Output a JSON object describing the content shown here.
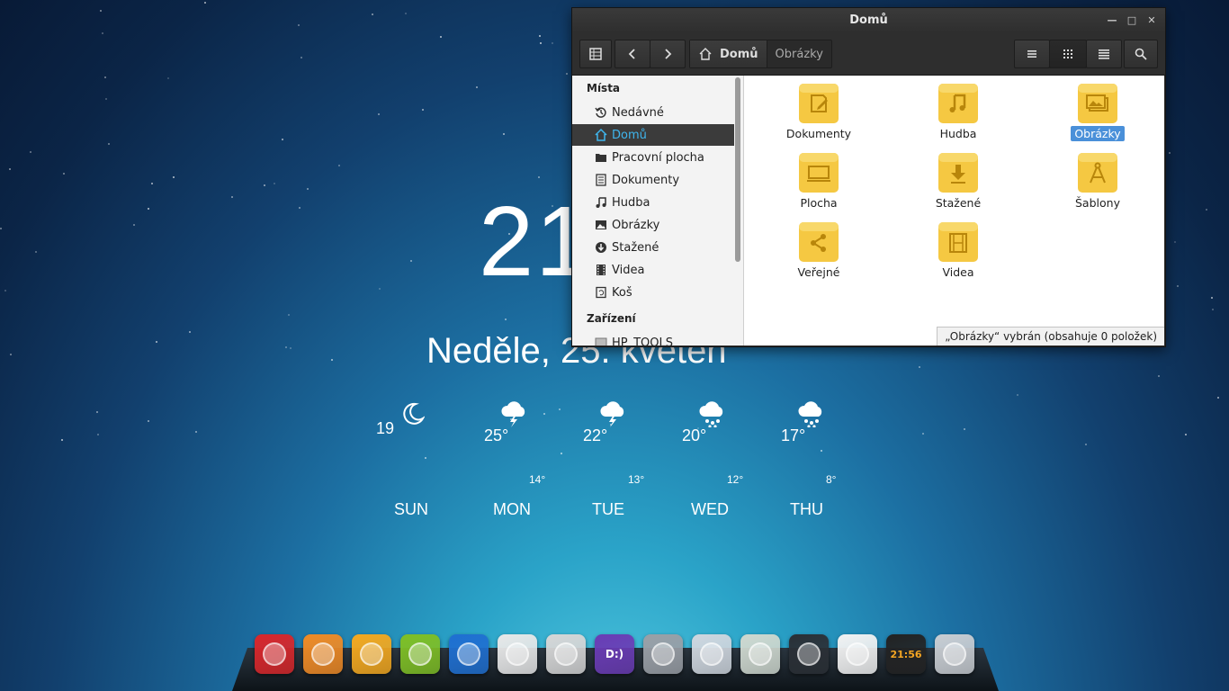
{
  "desktop": {
    "clock_text": "21",
    "date_text": "Neděle, 25. květen",
    "forecast": [
      {
        "day": "SUN",
        "high": "19",
        "low": "",
        "icon": "moon-icon"
      },
      {
        "day": "MON",
        "high": "25°",
        "low": "14°",
        "icon": "thunder-cloud-icon"
      },
      {
        "day": "TUE",
        "high": "22°",
        "low": "13°",
        "icon": "thunder-cloud-icon"
      },
      {
        "day": "WED",
        "high": "20°",
        "low": "12°",
        "icon": "rain-cloud-icon"
      },
      {
        "day": "THU",
        "high": "17°",
        "low": "8°",
        "icon": "rain-cloud-icon"
      }
    ]
  },
  "window": {
    "title": "Domů",
    "breadcrumb": [
      {
        "label": "Domů",
        "active": true
      },
      {
        "label": "Obrázky",
        "active": false
      }
    ],
    "sidebar": {
      "places_header": "Místa",
      "devices_header": "Zařízení",
      "items": [
        {
          "label": "Nedávné",
          "icon": "history-icon"
        },
        {
          "label": "Domů",
          "icon": "home-icon",
          "selected": true
        },
        {
          "label": "Pracovní plocha",
          "icon": "folder-icon"
        },
        {
          "label": "Dokumenty",
          "icon": "document-icon"
        },
        {
          "label": "Hudba",
          "icon": "music-icon"
        },
        {
          "label": "Obrázky",
          "icon": "image-icon"
        },
        {
          "label": "Stažené",
          "icon": "download-icon"
        },
        {
          "label": "Videa",
          "icon": "film-icon"
        },
        {
          "label": "Koš",
          "icon": "trash-icon"
        }
      ],
      "devices": [
        {
          "label": "HP_TOOLS",
          "icon": "drive-icon"
        }
      ]
    },
    "folders": [
      {
        "label": "Dokumenty",
        "icon": "pencil-doc-icon"
      },
      {
        "label": "Hudba",
        "icon": "music-note-icon"
      },
      {
        "label": "Obrázky",
        "icon": "pictures-icon",
        "selected": true
      },
      {
        "label": "Plocha",
        "icon": "desktop-icon"
      },
      {
        "label": "Stažené",
        "icon": "download-arrow-icon"
      },
      {
        "label": "Šablony",
        "icon": "compass-icon"
      },
      {
        "label": "Veřejné",
        "icon": "share-icon"
      },
      {
        "label": "Videa",
        "icon": "film-strip-icon"
      }
    ],
    "status_text": "„Obrázky“ vybrán  (obsahuje 0 položek)"
  },
  "dock": {
    "apps": [
      {
        "name": "rocket-launcher-icon",
        "color": "#d9262a"
      },
      {
        "name": "software-store-icon",
        "color": "#f08a24"
      },
      {
        "name": "swirl-app-icon",
        "color": "#f4a81e"
      },
      {
        "name": "music-player-icon",
        "color": "#7fbf24"
      },
      {
        "name": "browser-globe-icon",
        "color": "#1f6fd1"
      },
      {
        "name": "chrome-icon",
        "color": "#e8e8e8"
      },
      {
        "name": "file-manager-icon",
        "color": "#d6d6d6"
      },
      {
        "name": "deepin-music-icon",
        "color": "#6a3bb5",
        "label": "D:)"
      },
      {
        "name": "settings-gear-icon",
        "color": "#9a9fa6"
      },
      {
        "name": "network-globe-icon",
        "color": "#cfd6de"
      },
      {
        "name": "power-manager-icon",
        "color": "#cfd8cf"
      },
      {
        "name": "media-disc-icon",
        "color": "#2a2f35"
      },
      {
        "name": "dmusic-icon",
        "color": "#f2f2f2"
      },
      {
        "name": "clock-app-icon",
        "color": "#222222",
        "label": "21:56"
      },
      {
        "name": "trash-dock-icon",
        "color": "#c9cdd2"
      }
    ]
  }
}
